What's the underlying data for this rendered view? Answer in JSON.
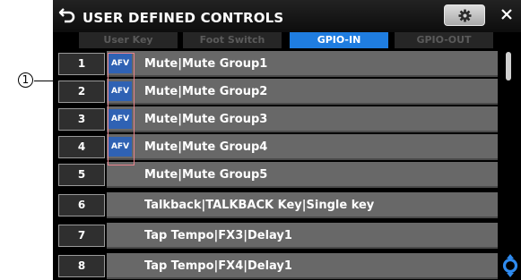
{
  "window": {
    "title": "USER DEFINED CONTROLS",
    "icons": {
      "back": "back-arrow-icon",
      "settings": "gear-icon",
      "close": "close-icon"
    }
  },
  "tabs": [
    {
      "label": "User Key",
      "active": false
    },
    {
      "label": "Foot Switch",
      "active": false
    },
    {
      "label": "GPIO-IN",
      "active": true
    },
    {
      "label": "GPIO-OUT",
      "active": false
    }
  ],
  "rows": [
    {
      "number": "1",
      "afv": "AFV",
      "name": "Mute|Mute Group1"
    },
    {
      "number": "2",
      "afv": "AFV",
      "name": "Mute|Mute Group2"
    },
    {
      "number": "3",
      "afv": "AFV",
      "name": "Mute|Mute Group3"
    },
    {
      "number": "4",
      "afv": "AFV",
      "name": "Mute|Mute Group4"
    },
    {
      "number": "5",
      "afv": "",
      "name": "Mute|Mute Group5"
    },
    {
      "number": "6",
      "afv": "",
      "name": "Talkback|TALKBACK Key|Single key"
    },
    {
      "number": "7",
      "afv": "",
      "name": "Tap Tempo|FX3|Delay1"
    },
    {
      "number": "8",
      "afv": "",
      "name": "Tap Tempo|FX4|Delay1"
    }
  ],
  "callout": {
    "label": "1"
  },
  "colors": {
    "active_tab": "#1f7de0",
    "afv_badge": "#2f62b4",
    "row_background": "#686868",
    "callout_border": "#e9838c"
  }
}
